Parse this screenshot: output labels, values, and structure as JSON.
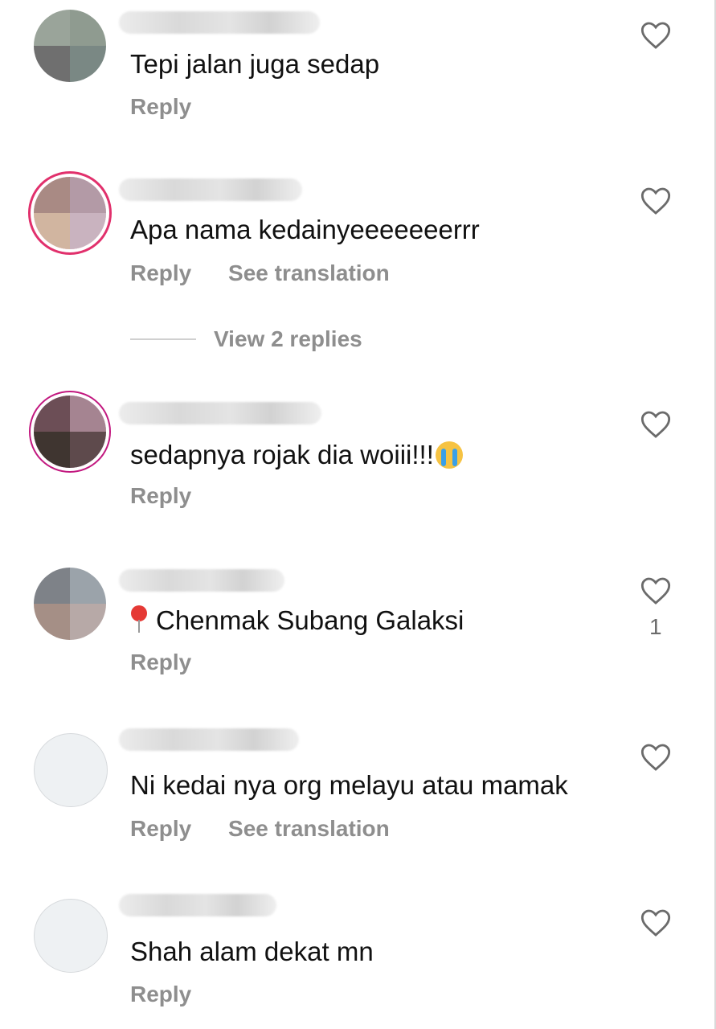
{
  "comments": [
    {
      "text": "Tepi jalan juga sedap",
      "actions": [
        "Reply"
      ],
      "likes": ""
    },
    {
      "text": "Apa nama kedainyeeeeeeerrr",
      "actions": [
        "Reply",
        "See translation"
      ],
      "likes": "",
      "view_replies": "View 2 replies"
    },
    {
      "text": "sedapnya rojak dia woiii!!!",
      "emoji": "loudly-crying-face",
      "actions": [
        "Reply"
      ],
      "likes": ""
    },
    {
      "text": "Chenmak Subang Galaksi",
      "emoji": "round-pushpin",
      "actions": [
        "Reply"
      ],
      "likes": "1"
    },
    {
      "text": "Ni kedai nya org melayu atau mamak",
      "actions": [
        "Reply",
        "See translation"
      ],
      "likes": ""
    },
    {
      "text": "Shah alam dekat mn",
      "actions": [
        "Reply"
      ],
      "likes": ""
    }
  ],
  "colors": {
    "ring": "#e1306c",
    "muted": "#8e8e8e"
  }
}
